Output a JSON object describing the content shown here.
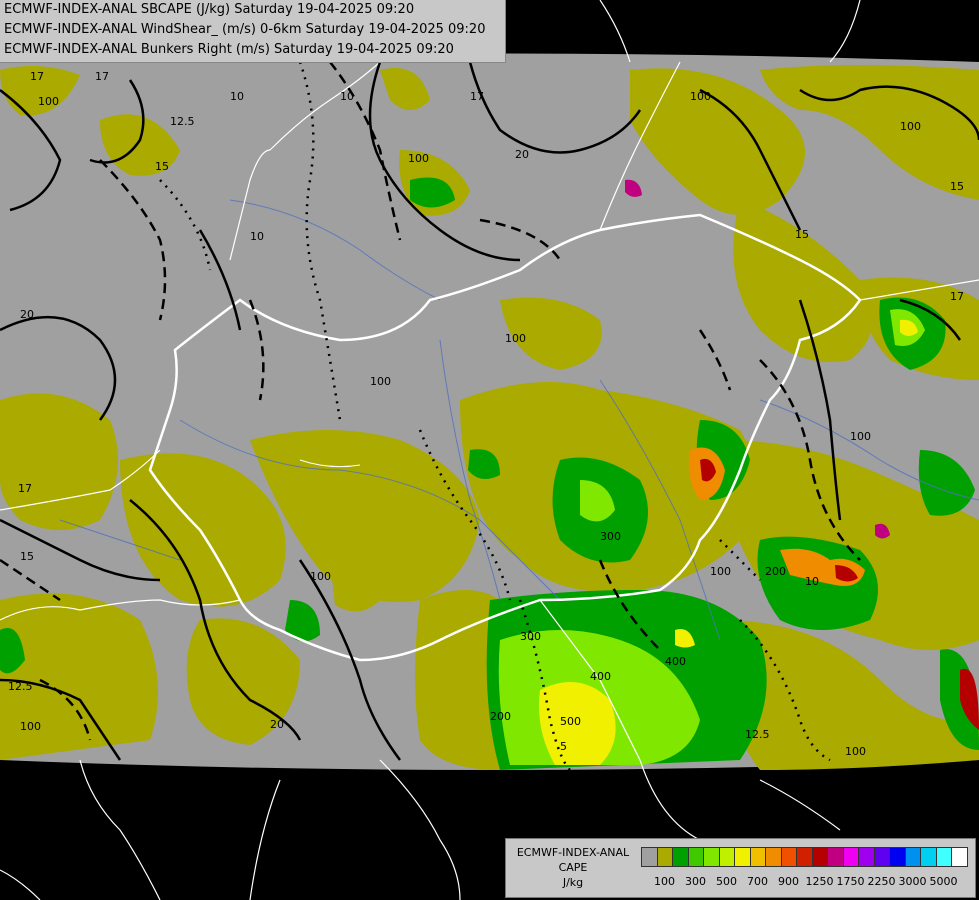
{
  "header": {
    "line1": "ECMWF-INDEX-ANAL SBCAPE (J/kg) Saturday 19-04-2025 09:20",
    "line2": "ECMWF-INDEX-ANAL WindShear_ (m/s) 0-6km Saturday 19-04-2025 09:20",
    "line3": "ECMWF-INDEX-ANAL Bunkers Right (m/s) Saturday 19-04-2025 09:20"
  },
  "legend": {
    "title_line1": "ECMWF-INDEX-ANAL",
    "title_line2": "CAPE",
    "title_line3": "J/kg",
    "swatch_colors": [
      "#a0a0a0",
      "#aaaa00",
      "#00a000",
      "#40c800",
      "#80e800",
      "#c0f000",
      "#f0f000",
      "#f0c000",
      "#f08c00",
      "#f05000",
      "#d02000",
      "#b40000",
      "#c00080",
      "#f000f0",
      "#a000f0",
      "#6000f0",
      "#0000f0",
      "#0090f0",
      "#00d0f0",
      "#40ffff",
      "#ffffff"
    ],
    "ticks": [
      "100",
      "300",
      "500",
      "700",
      "900",
      "1250",
      "1750",
      "2250",
      "3000",
      "5000"
    ]
  },
  "map_labels": {
    "shear": [
      "17",
      "17",
      "12.5",
      "10",
      "10",
      "15",
      "20",
      "20",
      "15",
      "17",
      "17",
      "15",
      "12.5",
      "17",
      "20",
      "12.5"
    ],
    "cape": [
      "100",
      "100",
      "100",
      "100",
      "100",
      "100",
      "100",
      "100",
      "100",
      "200",
      "300",
      "300",
      "400",
      "400",
      "500",
      "200",
      "100",
      "100"
    ],
    "bunkers": [
      "15",
      "10",
      "10",
      "5"
    ]
  },
  "colors": {
    "cape_100": "#aaaa00",
    "cape_300": "#00a000",
    "cape_500": "#80e800",
    "cape_700": "#f0f000",
    "cape_900": "#f08c00",
    "cape_1250": "#b40000",
    "background_grey": "#a0a0a0",
    "outside": "#000000",
    "border": "#ffffff"
  }
}
